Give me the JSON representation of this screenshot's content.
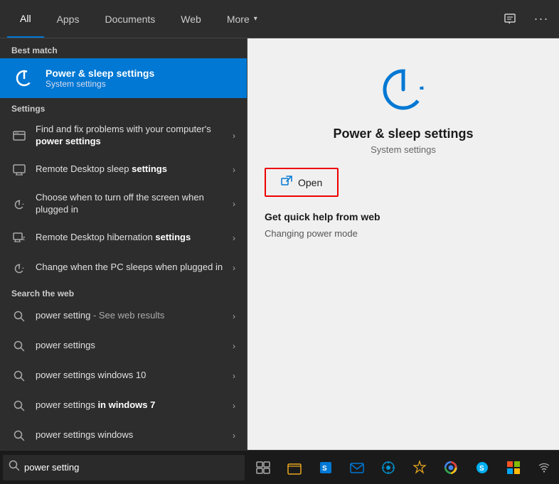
{
  "topNav": {
    "tabs": [
      {
        "id": "all",
        "label": "All",
        "active": true
      },
      {
        "id": "apps",
        "label": "Apps",
        "active": false
      },
      {
        "id": "documents",
        "label": "Documents",
        "active": false
      },
      {
        "id": "web",
        "label": "Web",
        "active": false
      },
      {
        "id": "more",
        "label": "More",
        "active": false,
        "hasDropdown": true
      }
    ],
    "feedbackIcon": "⌘",
    "moreIcon": "···"
  },
  "leftPanel": {
    "bestMatchLabel": "Best match",
    "bestMatch": {
      "title": "Power & sleep settings",
      "subtitle": "System settings"
    },
    "settingsLabel": "Settings",
    "settingsItems": [
      {
        "text": "Find and fix problems with your computer's ",
        "bold": "power settings"
      },
      {
        "text": "Remote Desktop sleep ",
        "bold": "settings"
      },
      {
        "text": "Choose when to turn off the screen when plugged in",
        "bold": ""
      },
      {
        "text": "Remote Desktop hibernation ",
        "bold": "settings"
      },
      {
        "text": "Change when the PC sleeps when plugged in",
        "bold": ""
      }
    ],
    "webLabel": "Search the web",
    "webItems": [
      {
        "text": "power setting",
        "suffix": " - See web results"
      },
      {
        "text": "power settings",
        "suffix": ""
      },
      {
        "text": "power settings windows 10",
        "suffix": ""
      },
      {
        "text": "power settings ",
        "bold": "in windows 7",
        "suffix": ""
      },
      {
        "text": "power settings windows",
        "suffix": ""
      }
    ]
  },
  "rightPanel": {
    "title": "Power & sleep settings",
    "subtitle": "System settings",
    "openLabel": "Open",
    "quickHelpTitle": "Get quick help from web",
    "quickHelpItems": [
      "Changing power mode"
    ]
  },
  "taskbar": {
    "searchPlaceholder": "power setting",
    "searchValue": "power setting"
  }
}
